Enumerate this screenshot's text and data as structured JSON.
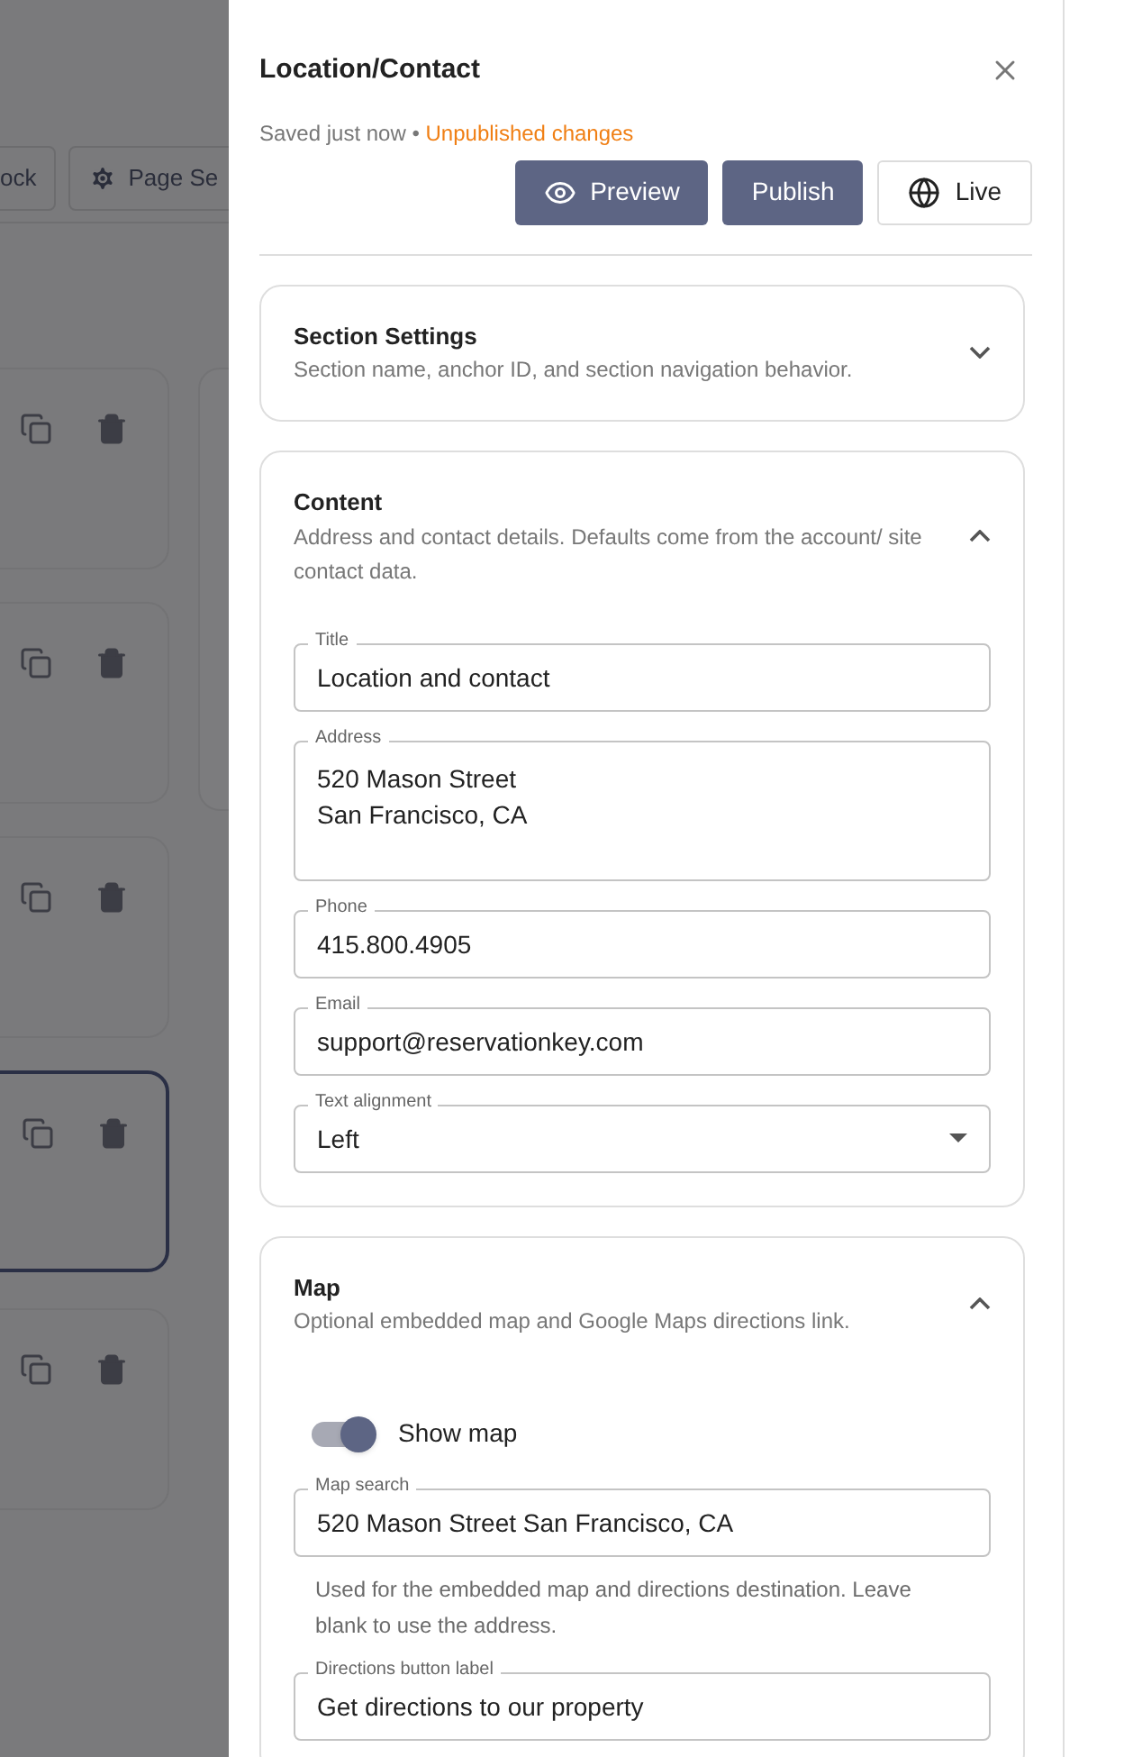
{
  "background": {
    "toolbar_buttons": [
      {
        "label": "ock",
        "kind": "plain"
      },
      {
        "label": "Page Se",
        "kind": "gear"
      }
    ],
    "block_cards": [
      {
        "selected": false
      },
      {
        "selected": false
      },
      {
        "selected": false
      },
      {
        "selected": true
      },
      {
        "selected": false
      }
    ]
  },
  "panel": {
    "title": "Location/Contact",
    "save_status": "Saved just now •",
    "unpublished": "Unpublished changes",
    "actions": [
      {
        "label": "Preview",
        "kind": "preview"
      },
      {
        "label": "Publish",
        "kind": "publish"
      },
      {
        "label": "Live",
        "kind": "live"
      }
    ],
    "sections": [
      {
        "title": "Section Settings",
        "description": "Section name, anchor ID, and section navigation behavior.",
        "expanded": false
      },
      {
        "title": "Content",
        "description": "Address and contact details. Defaults come from the account/ site contact data.",
        "expanded": true,
        "fields": [
          {
            "kind": "text",
            "label": "Title",
            "value": "Location and contact"
          },
          {
            "kind": "textarea",
            "label": "Address",
            "value": "520 Mason Street\nSan Francisco, CA"
          },
          {
            "kind": "text",
            "label": "Phone",
            "value": "415.800.4905"
          },
          {
            "kind": "text",
            "label": "Email",
            "value": "support@reservationkey.com"
          },
          {
            "kind": "select",
            "label": "Text alignment",
            "value": "Left"
          }
        ]
      },
      {
        "title": "Map",
        "description": "Optional embedded map and Google Maps directions link.",
        "expanded": true,
        "fields": [
          {
            "kind": "switch",
            "label": "Show map",
            "on": true
          },
          {
            "kind": "text",
            "label": "Map search",
            "value": "520 Mason Street San Francisco, CA"
          },
          {
            "kind": "hint",
            "text": "Used for the embedded map and directions destination. Leave blank to use the address."
          },
          {
            "kind": "text",
            "label": "Directions button label",
            "value": "Get directions to our property"
          }
        ]
      }
    ]
  }
}
